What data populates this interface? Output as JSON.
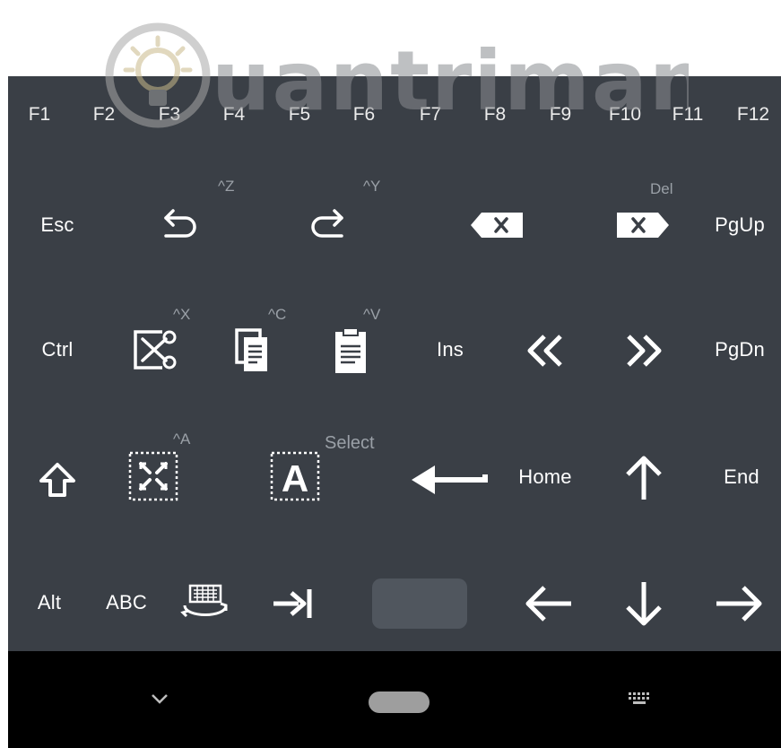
{
  "function_row": [
    "F1",
    "F2",
    "F3",
    "F4",
    "F5",
    "F6",
    "F7",
    "F8",
    "F9",
    "F10",
    "F11",
    "F12"
  ],
  "row1": {
    "esc": "Esc",
    "undo_hint": "^Z",
    "redo_hint": "^Y",
    "delete_hint": "Del",
    "pgup": "PgUp"
  },
  "row2": {
    "ctrl": "Ctrl",
    "cut_hint": "^X",
    "copy_hint": "^C",
    "paste_hint": "^V",
    "ins": "Ins",
    "pgdn": "PgDn"
  },
  "row3": {
    "select_all_hint": "^A",
    "select_hint": "Select",
    "home": "Home",
    "end": "End"
  },
  "row4": {
    "alt": "Alt",
    "abc": "ABC"
  },
  "icons": {
    "undo": "undo-icon",
    "redo": "redo-icon",
    "backspace": "backspace-icon",
    "delete": "delete-forward-icon",
    "cut": "cut-icon",
    "copy": "copy-icon",
    "paste": "paste-icon",
    "word_left": "double-chevron-left-icon",
    "word_right": "double-chevron-right-icon",
    "shift": "shift-icon",
    "select_all": "select-all-icon",
    "select": "select-text-icon",
    "enter": "enter-icon",
    "up": "arrow-up-icon",
    "keyboard_switch": "keyboard-switch-icon",
    "tab": "tab-icon",
    "left": "arrow-left-icon",
    "down": "arrow-down-icon",
    "right": "arrow-right-icon",
    "nav_back": "chevron-down-icon",
    "nav_home": "home-pill-icon",
    "nav_keyboard": "keyboard-icon"
  },
  "watermark": "Quantrimang",
  "colors": {
    "keyboard_bg": "#3a3f46",
    "key_text": "#ffffff",
    "hint_text": "#9aa0a7",
    "space_key": "#50565e",
    "navbar_bg": "#000000"
  }
}
